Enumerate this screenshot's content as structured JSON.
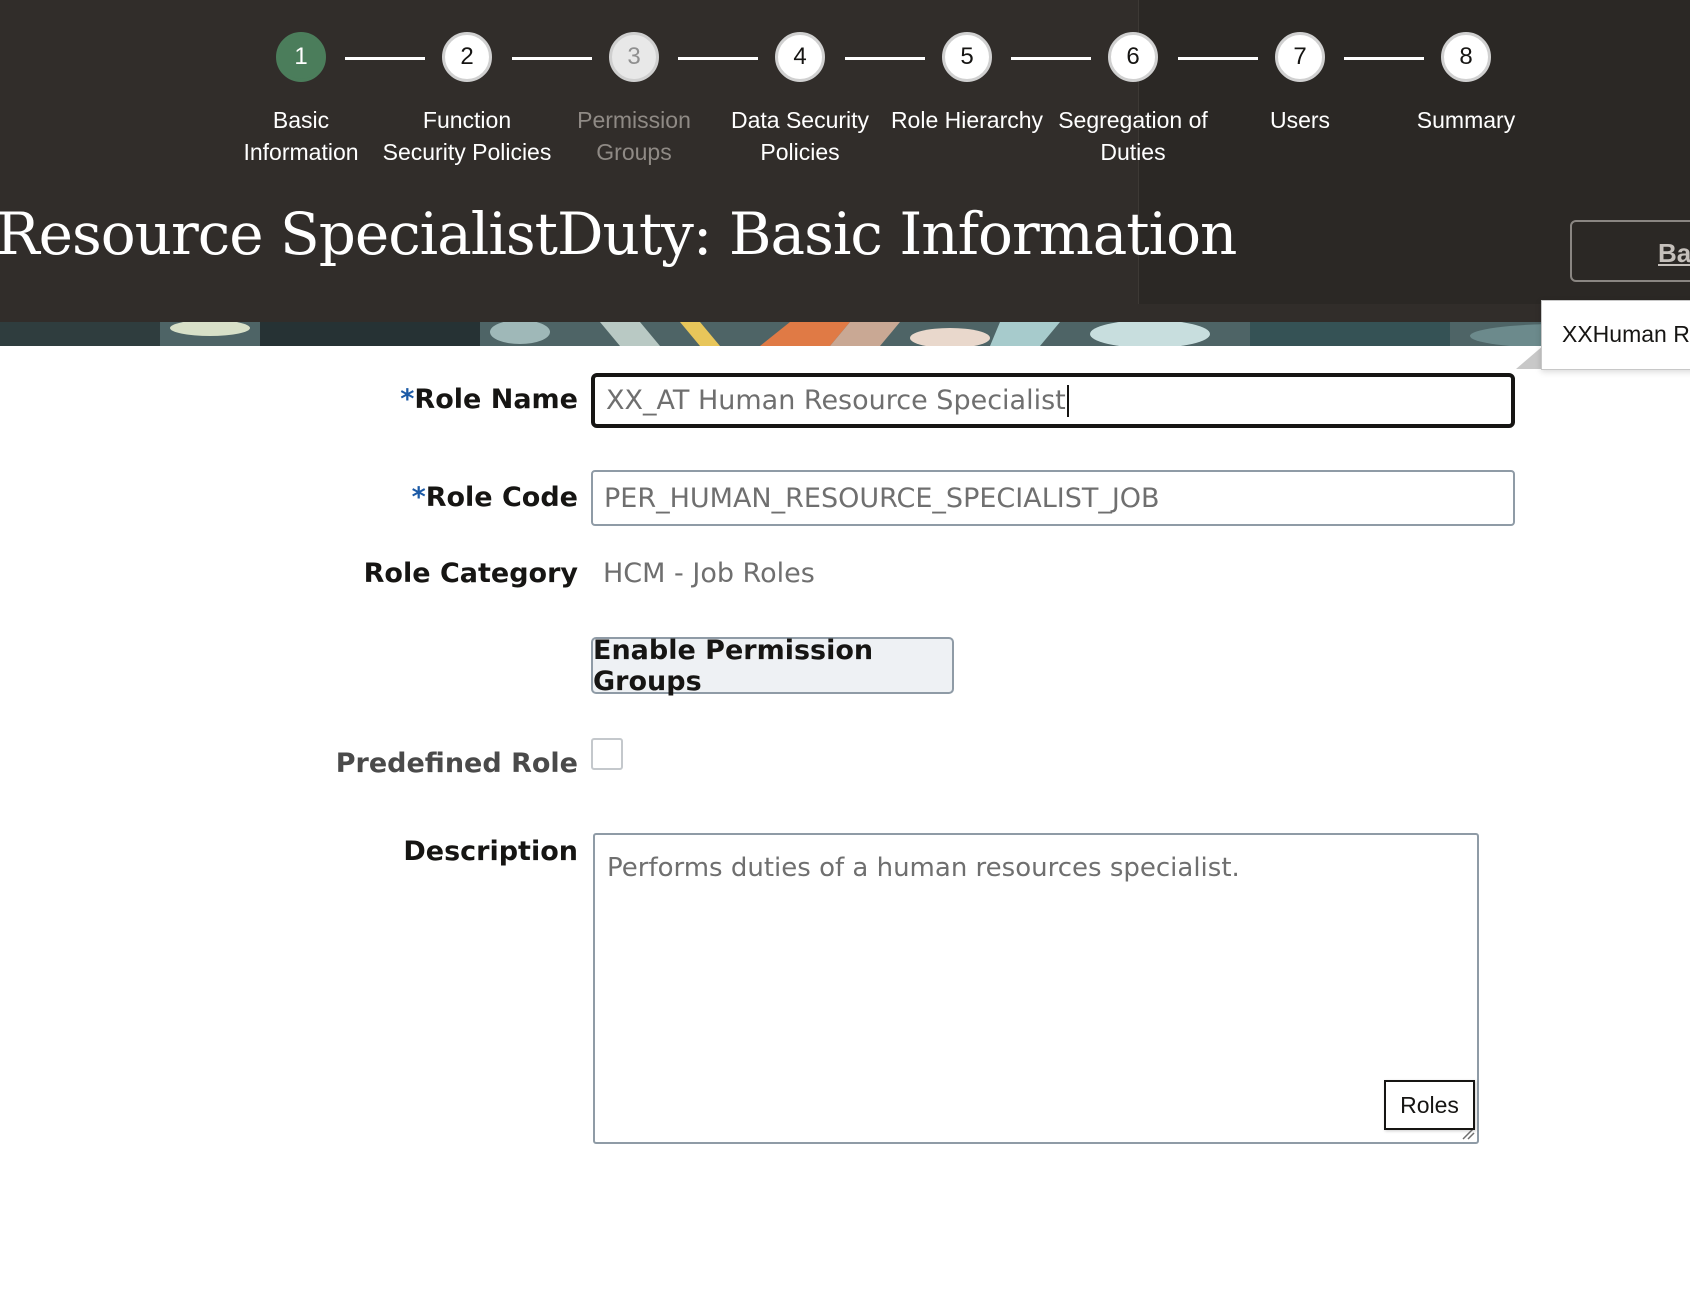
{
  "train": {
    "steps": [
      {
        "number": "1",
        "label": "Basic\nInformation",
        "state": "active"
      },
      {
        "number": "2",
        "label": "Function\nSecurity Policies",
        "state": "normal"
      },
      {
        "number": "3",
        "label": "Permission\nGroups",
        "state": "disabled"
      },
      {
        "number": "4",
        "label": "Data Security\nPolicies",
        "state": "normal"
      },
      {
        "number": "5",
        "label": "Role Hierarchy",
        "state": "normal"
      },
      {
        "number": "6",
        "label": "Segregation of\nDuties",
        "state": "normal"
      },
      {
        "number": "7",
        "label": "Users",
        "state": "normal"
      },
      {
        "number": "8",
        "label": "Summary",
        "state": "normal"
      }
    ]
  },
  "header": {
    "title": "Resource SpecialistDuty: Basic Information",
    "back_button": "Ba",
    "tooltip": "XXHuman R"
  },
  "form": {
    "role_name": {
      "label": "Role Name",
      "required_mark": "*",
      "value": "XX_AT Human Resource Specialist"
    },
    "role_code": {
      "label": "Role Code",
      "required_mark": "*",
      "value": "PER_HUMAN_RESOURCE_SPECIALIST_JOB"
    },
    "role_category": {
      "label": "Role Category",
      "value": "HCM - Job Roles"
    },
    "enable_permission_groups": "Enable Permission Groups",
    "predefined_role": {
      "label": "Predefined Role",
      "checked": false
    },
    "description": {
      "label": "Description",
      "value": "Performs duties of a human resources specialist."
    },
    "roles_tip": "Roles"
  },
  "colors": {
    "header_bg": "#312d2a",
    "active_step": "#4b7d5b",
    "required_asterisk": "#1c5aa6"
  }
}
